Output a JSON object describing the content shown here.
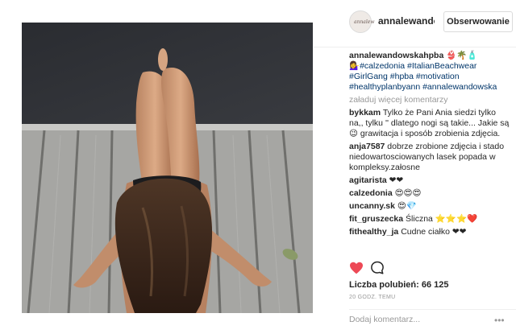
{
  "header": {
    "username": "annalewandow",
    "follow_label": "Obserwowanie",
    "avatar_text": "annalew"
  },
  "caption": {
    "username": "annalewandowskahpba",
    "emoji_line": "👙🌴🧴",
    "text": "💁‍♀️#calzedonia #ItalianBeachwear #GirlGang #hpba #motivation #healthyplanbyann #annalewandowska"
  },
  "load_more": "załaduj więcej komentarzy",
  "comments": [
    {
      "user": "bykkam",
      "text": "Tylko że Pani Ania siedzi tylko na,, tylku '' dlatego nogi są takie... Jakie są 😉 grawitacja i sposób zrobienia zdjęcia."
    },
    {
      "user": "anja7587",
      "text": "dobrze zrobione zdjęcia i stado niedowartosciowanych lasek popada w kompleksy.załosne"
    },
    {
      "user": "agitarista",
      "text": "❤❤"
    },
    {
      "user": "calzedonia",
      "text": "😍😍😍"
    },
    {
      "user": "uncanny.sk",
      "text": "😍💎"
    },
    {
      "user": "fit_gruszecka",
      "text": "Śliczna ⭐⭐⭐❤️"
    },
    {
      "user": "fithealthy_ja",
      "text": "Cudne ciałko ❤❤"
    }
  ],
  "likes": "Liczba polubień: 66 125",
  "time": "20 GODZ. TEMU",
  "add_comment_placeholder": "Dodaj komentarz...",
  "more_options": "•••",
  "colors": {
    "like": "#ed4956",
    "link": "#003569",
    "muted": "#999999"
  }
}
